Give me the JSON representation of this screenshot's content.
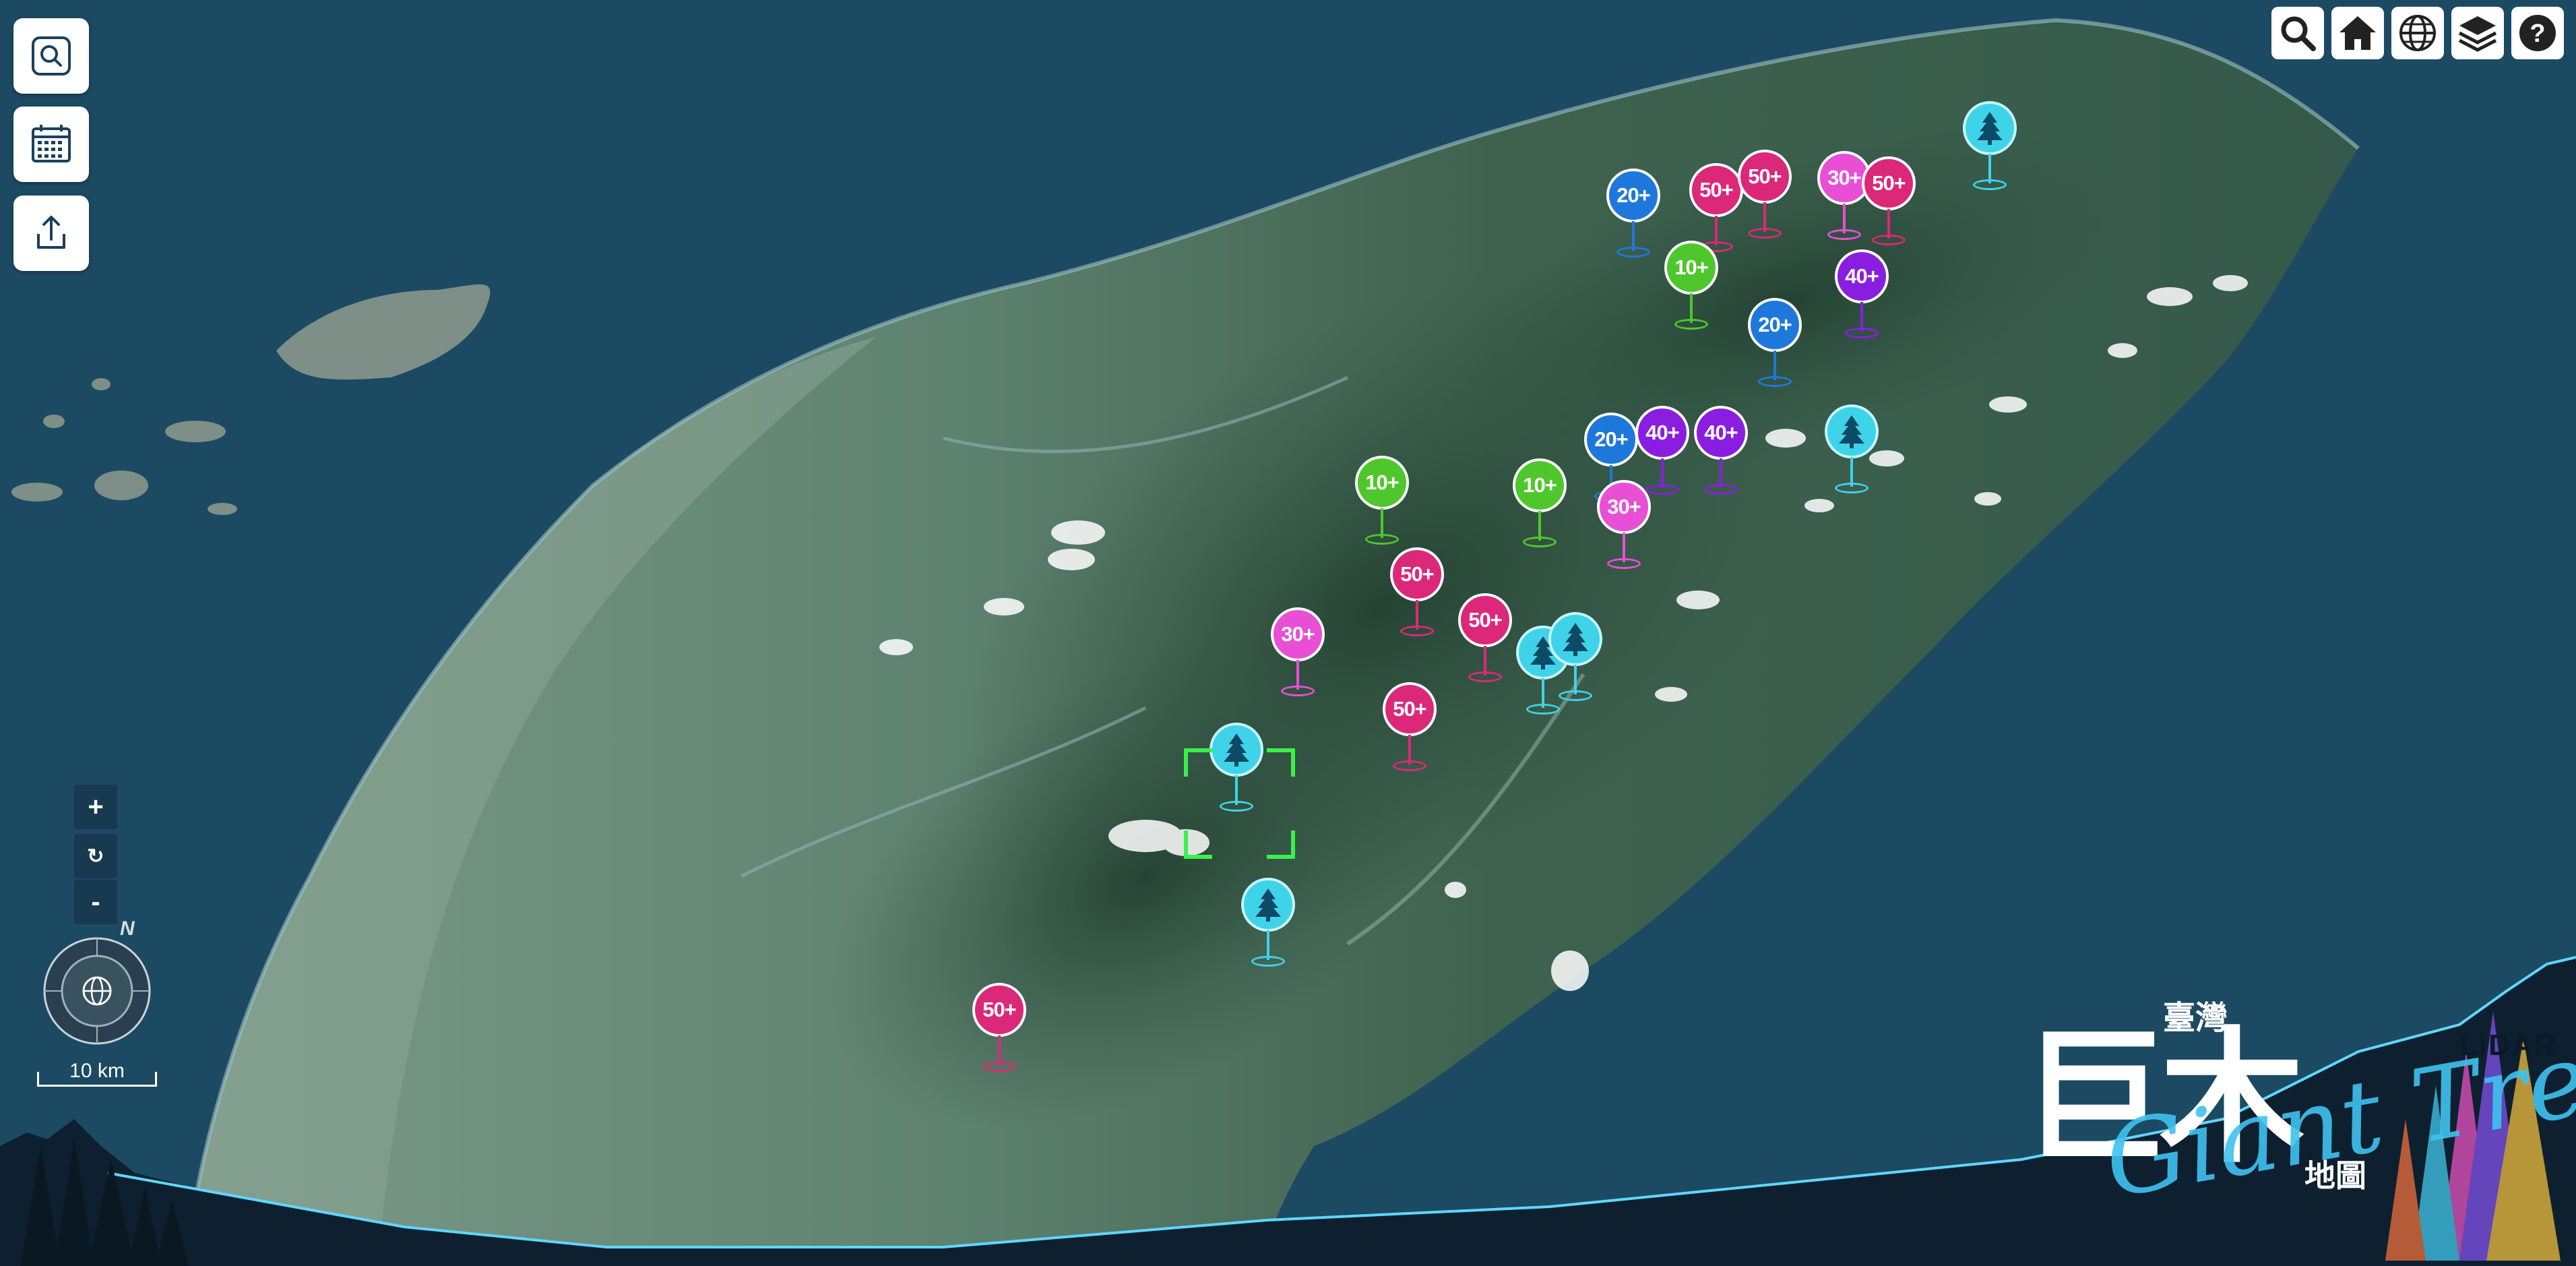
{
  "map": {
    "scale_label": "10 km",
    "compass_north": "N",
    "zoom_in_label": "+",
    "zoom_reset_label": "↻",
    "zoom_out_label": "-"
  },
  "logo": {
    "top_text": "臺灣",
    "main_text": "巨木",
    "sub_text": "地圖",
    "script_text": "Giant Tree",
    "badge_text": "LiDAR"
  },
  "left_toolbar": [
    {
      "icon": "search-frame-icon"
    },
    {
      "icon": "calendar-icon"
    },
    {
      "icon": "share-icon"
    }
  ],
  "top_toolbar": [
    {
      "icon": "search-icon"
    },
    {
      "icon": "home-icon"
    },
    {
      "icon": "globe-icon"
    },
    {
      "icon": "layers-icon"
    },
    {
      "icon": "help-icon",
      "label": "?"
    }
  ],
  "colors": {
    "10+": "#4fc72c",
    "20+": "#1e78dc",
    "30+": "#e84fd4",
    "40+": "#8a1ee0",
    "50+": "#dc2878",
    "tree": "#3fd3ea",
    "ocean": "#1c4a63",
    "selection": "#3cf04a"
  },
  "clusters": [
    {
      "label": "20+"
    },
    {
      "label": "50+"
    },
    {
      "label": "50+"
    },
    {
      "label": "30+"
    },
    {
      "label": "50+"
    },
    {
      "label": "10+"
    },
    {
      "label": "40+"
    },
    {
      "label": "20+"
    },
    {
      "label": "20+"
    },
    {
      "label": "40+"
    },
    {
      "label": "40+"
    },
    {
      "label": "10+"
    },
    {
      "label": "10+"
    },
    {
      "label": "30+"
    },
    {
      "label": "50+"
    },
    {
      "label": "50+"
    },
    {
      "label": "30+"
    },
    {
      "label": "50+"
    },
    {
      "label": "50+"
    }
  ],
  "trees": [
    {
      "icon": "tree-icon"
    },
    {
      "icon": "tree-icon"
    },
    {
      "icon": "tree-icon"
    },
    {
      "icon": "tree-icon"
    },
    {
      "icon": "tree-icon"
    },
    {
      "icon": "tree-icon"
    }
  ]
}
